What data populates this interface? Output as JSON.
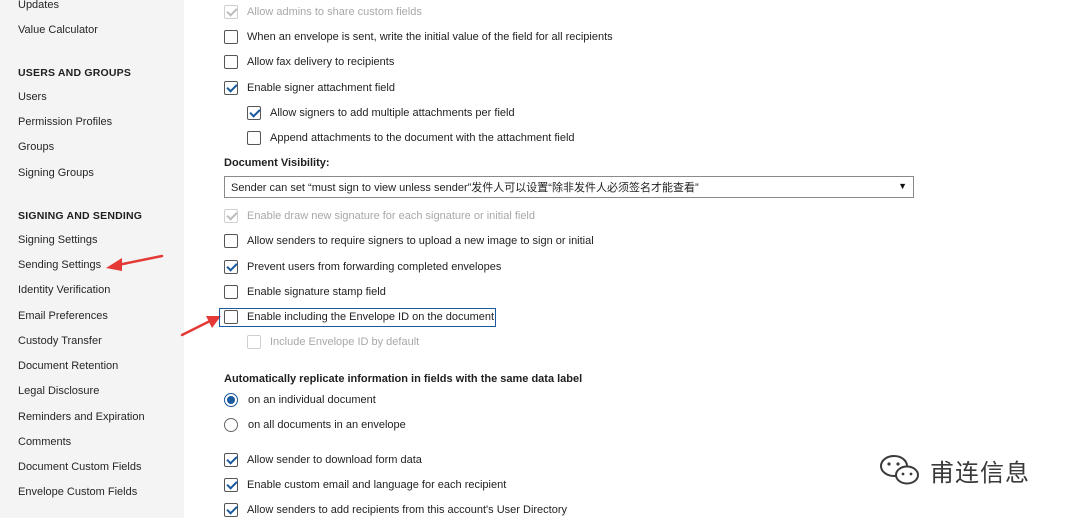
{
  "sidebar": {
    "items_top": [
      {
        "label": "Updates"
      },
      {
        "label": "Value Calculator"
      }
    ],
    "users_groups": {
      "heading": "USERS AND GROUPS",
      "items": [
        {
          "label": "Users"
        },
        {
          "label": "Permission Profiles"
        },
        {
          "label": "Groups"
        },
        {
          "label": "Signing Groups"
        }
      ]
    },
    "signing_sending": {
      "heading": "SIGNING AND SENDING",
      "items": [
        {
          "label": "Signing Settings"
        },
        {
          "label": "Sending Settings"
        },
        {
          "label": "Identity Verification"
        },
        {
          "label": "Email Preferences"
        },
        {
          "label": "Custody Transfer"
        },
        {
          "label": "Document Retention"
        },
        {
          "label": "Legal Disclosure"
        },
        {
          "label": "Reminders and Expiration"
        },
        {
          "label": "Comments"
        },
        {
          "label": "Document Custom Fields"
        },
        {
          "label": "Envelope Custom Fields"
        }
      ]
    }
  },
  "main": {
    "options_a": [
      {
        "label": "Allow admins to share custom fields",
        "checked": true,
        "disabled": true
      },
      {
        "label": "When an envelope is sent, write the initial value of the field for all recipients",
        "checked": false
      },
      {
        "label": "Allow fax delivery to recipients",
        "checked": false
      },
      {
        "label": "Enable signer attachment field",
        "checked": true
      },
      {
        "label": "Allow signers to add multiple attachments per field",
        "checked": true
      },
      {
        "label": "Append attachments to the document with the attachment field",
        "checked": false
      }
    ],
    "document_visibility": {
      "label": "Document Visibility:",
      "selected": "Sender can set “must sign to view unless sender”发件人可以设置“除非发件人必须签名才能查看”"
    },
    "options_b": [
      {
        "label": "Enable draw new signature for each signature or initial field",
        "checked": true,
        "disabled": true
      },
      {
        "label": "Allow senders to require signers to upload a new image to sign or initial",
        "checked": false
      },
      {
        "label": "Prevent users from forwarding completed envelopes",
        "checked": true
      },
      {
        "label": "Enable signature stamp field",
        "checked": false
      },
      {
        "label": "Enable including the Envelope ID on the document",
        "checked": false
      },
      {
        "label": "Include Envelope ID by default",
        "checked": false,
        "disabled": true
      }
    ],
    "replicate": {
      "label": "Automatically replicate information in fields with the same data label",
      "options": [
        {
          "label": "on an individual document",
          "selected": true
        },
        {
          "label": "on all documents in an envelope",
          "selected": false
        }
      ]
    },
    "options_c": [
      {
        "label": "Allow sender to download form data",
        "checked": true
      },
      {
        "label": "Enable custom email and language for each recipient",
        "checked": true
      },
      {
        "label": "Allow senders to add recipients from this account's User Directory",
        "checked": true
      }
    ]
  },
  "watermark": {
    "text": "甫连信息",
    "icon": "wechat-icon"
  },
  "colors": {
    "accent": "#1a5a9e",
    "annotation_arrow": "#e53935",
    "sidebar_bg": "#f4f4f4"
  }
}
